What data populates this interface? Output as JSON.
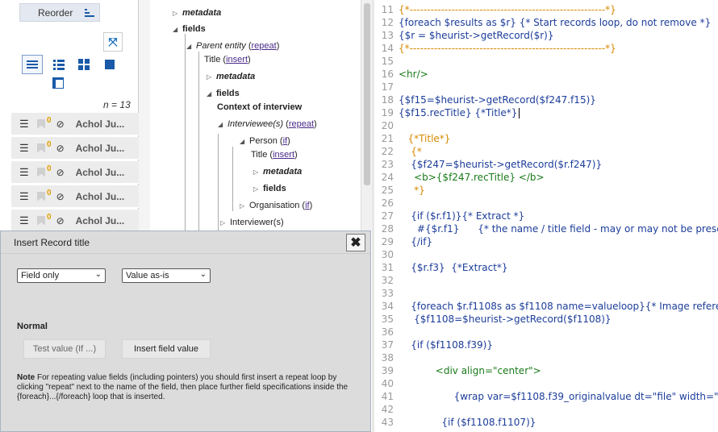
{
  "left": {
    "reorder_label": "Reorder",
    "count_label": "n = 13",
    "records": [
      {
        "title": "Achol Ju...",
        "bookmarks": "0"
      },
      {
        "title": "Achol Ju...",
        "bookmarks": "0"
      },
      {
        "title": "Achol Ju...",
        "bookmarks": "0"
      },
      {
        "title": "Achol Ju...",
        "bookmarks": "0"
      },
      {
        "title": "Achol Ju...",
        "bookmarks": "0"
      }
    ]
  },
  "tree": {
    "metadata1": "metadata",
    "fields1": "fields",
    "parent_entity": "Parent entity",
    "repeat": "repeat",
    "title": "Title",
    "insert": "insert",
    "metadata2": "metadata",
    "fields2": "fields",
    "context": "Context of interview",
    "interviewees": "Interviewee(s)",
    "person": "Person",
    "if": "if",
    "title2": "Title",
    "metadata3": "metadata",
    "fields3": "fields",
    "organisation": "Organisation",
    "interviewers": "Interviewer(s)"
  },
  "editor": {
    "lines": [
      {
        "n": "11",
        "t": "{*--------------------------------------------------------*}"
      },
      {
        "n": "12",
        "t": "{foreach $results as $r} {* Start records loop, do not remove *}"
      },
      {
        "n": "13",
        "t": "{$r = $heurist->getRecord($r)}"
      },
      {
        "n": "14",
        "t": "{*--------------------------------------------------------*}"
      },
      {
        "n": "15",
        "t": ""
      },
      {
        "n": "16",
        "t": "<hr/>"
      },
      {
        "n": "17",
        "t": ""
      },
      {
        "n": "18",
        "t": "{$f15=$heurist->getRecord($f247.f15)}"
      },
      {
        "n": "19",
        "t": "{$f15.recTitle} {*Title*}"
      },
      {
        "n": "20",
        "t": ""
      },
      {
        "n": "21",
        "t": "   {*Title*}"
      },
      {
        "n": "22",
        "t": "    {*"
      },
      {
        "n": "23",
        "t": "    {$f247=$heurist->getRecord($r.f247)}"
      },
      {
        "n": "24",
        "t": "     <b>{$f247.recTitle} </b>"
      },
      {
        "n": "25",
        "t": "     *}"
      },
      {
        "n": "26",
        "t": ""
      },
      {
        "n": "27",
        "t": "    {if ($r.f1)}{* Extract *}"
      },
      {
        "n": "28",
        "t": "      #{$r.f1}      {* the name / title field - may or may not be prese"
      },
      {
        "n": "29",
        "t": "    {/if}"
      },
      {
        "n": "30",
        "t": ""
      },
      {
        "n": "31",
        "t": "    {$r.f3}  {*Extract*}"
      },
      {
        "n": "32",
        "t": ""
      },
      {
        "n": "33",
        "t": ""
      },
      {
        "n": "34",
        "t": "    {foreach $r.f1108s as $f1108 name=valueloop}{* Image refere"
      },
      {
        "n": "35",
        "t": "     {$f1108=$heurist->getRecord($f1108)}"
      },
      {
        "n": "36",
        "t": ""
      },
      {
        "n": "37",
        "t": "    {if ($f1108.f39)}"
      },
      {
        "n": "38",
        "t": ""
      },
      {
        "n": "39",
        "t": "            <div align=\"center\">"
      },
      {
        "n": "40",
        "t": ""
      },
      {
        "n": "41",
        "t": "                  {wrap var=$f1108.f39_originalvalue dt=\"file\" width=\""
      },
      {
        "n": "42",
        "t": ""
      },
      {
        "n": "43",
        "t": "              {if ($f1108.f1107)}"
      }
    ]
  },
  "dialog": {
    "title": "Insert Record title",
    "close_glyph": "✖",
    "select1": "Field only",
    "select2": "Value as-is",
    "normal_label": "Normal",
    "test_button": "Test value (If ...)",
    "insert_button": "Insert field value",
    "note_bold": "Note",
    "note_text": " For repeating value fields (including pointers) you should first insert a repeat loop by clicking \"repeat\" next to the name of the field, then place further field specifications inside the {foreach}...{/foreach} loop that is inserted."
  }
}
